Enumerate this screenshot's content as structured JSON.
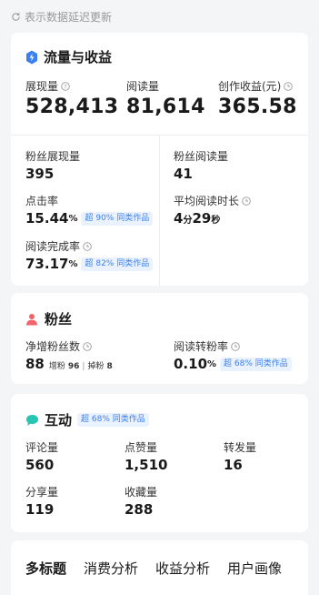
{
  "notice": {
    "text": "表示数据延迟更新"
  },
  "traffic": {
    "title": "流量与收益",
    "impressions": {
      "label": "展现量",
      "value": "528,413"
    },
    "reads": {
      "label": "阅读量",
      "value": "81,614"
    },
    "earnings": {
      "label": "创作收益(元)",
      "value": "365.58"
    },
    "fan_impressions": {
      "label": "粉丝展现量",
      "value": "395"
    },
    "fan_reads": {
      "label": "粉丝阅读量",
      "value": "41"
    },
    "ctr": {
      "label": "点击率",
      "value": "15.44",
      "unit": "%",
      "badge": "超 90% 同类作品"
    },
    "avg_read_time": {
      "label": "平均阅读时长",
      "minutes": "4",
      "min_unit": "分",
      "seconds": "29",
      "sec_unit": "秒"
    },
    "completion": {
      "label": "阅读完成率",
      "value": "73.17",
      "unit": "%",
      "badge": "超 82% 同类作品"
    }
  },
  "fans": {
    "title": "粉丝",
    "net_gain": {
      "label": "净增粉丝数",
      "value": "88",
      "gain_label": "增粉",
      "gain_value": "96",
      "sep": "|",
      "lost_label": "掉粉",
      "lost_value": "8"
    },
    "conversion": {
      "label": "阅读转粉率",
      "value": "0.10",
      "unit": "%",
      "badge": "超 68% 同类作品"
    }
  },
  "interaction": {
    "title": "互动",
    "badge": "超 68% 同类作品",
    "comments": {
      "label": "评论量",
      "value": "560"
    },
    "likes": {
      "label": "点赞量",
      "value": "1,510"
    },
    "reposts": {
      "label": "转发量",
      "value": "16"
    },
    "shares": {
      "label": "分享量",
      "value": "119"
    },
    "favorites": {
      "label": "收藏量",
      "value": "288"
    }
  },
  "tabs": [
    "多标题",
    "消费分析",
    "收益分析",
    "用户画像"
  ],
  "colors": {
    "accent": "#3b7ff0",
    "badge_bg": "#eaf2ff",
    "fans_icon": "#f0646c",
    "interaction_icon": "#26c6b0"
  }
}
